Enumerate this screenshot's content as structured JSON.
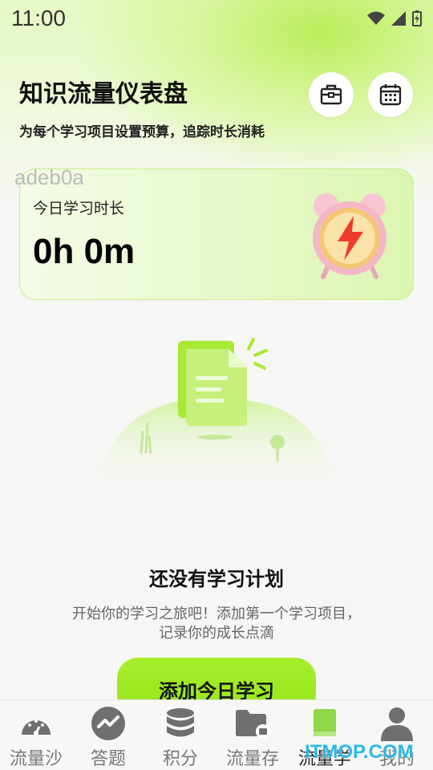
{
  "status_bar": {
    "time": "11:00"
  },
  "header": {
    "title": "知识流量仪表盘",
    "subtitle": "为每个学习项目设置预算，追踪时长消耗"
  },
  "watermark": "adeb0a",
  "today_card": {
    "label": "今日学习时长",
    "value": "0h 0m"
  },
  "empty_state": {
    "title": "还没有学习计划",
    "desc_line1": "开始你的学习之旅吧！添加第一个学习项目，",
    "desc_line2": "记录你的成长点滴"
  },
  "add_button": "添加今日学习",
  "nav": [
    {
      "label": "流量沙",
      "icon": "gauge-icon"
    },
    {
      "label": "答题",
      "icon": "trend-icon"
    },
    {
      "label": "积分",
      "icon": "coins-icon"
    },
    {
      "label": "流量存",
      "icon": "folder-icon"
    },
    {
      "label": "流量学",
      "icon": "book-icon"
    },
    {
      "label": "我的",
      "icon": "person-icon"
    }
  ],
  "site_watermark": "ITMOP.COM",
  "colors": {
    "accent": "#9be61f",
    "card_border": "#c9ee8a",
    "icon_gray": "#6f6f6f"
  }
}
